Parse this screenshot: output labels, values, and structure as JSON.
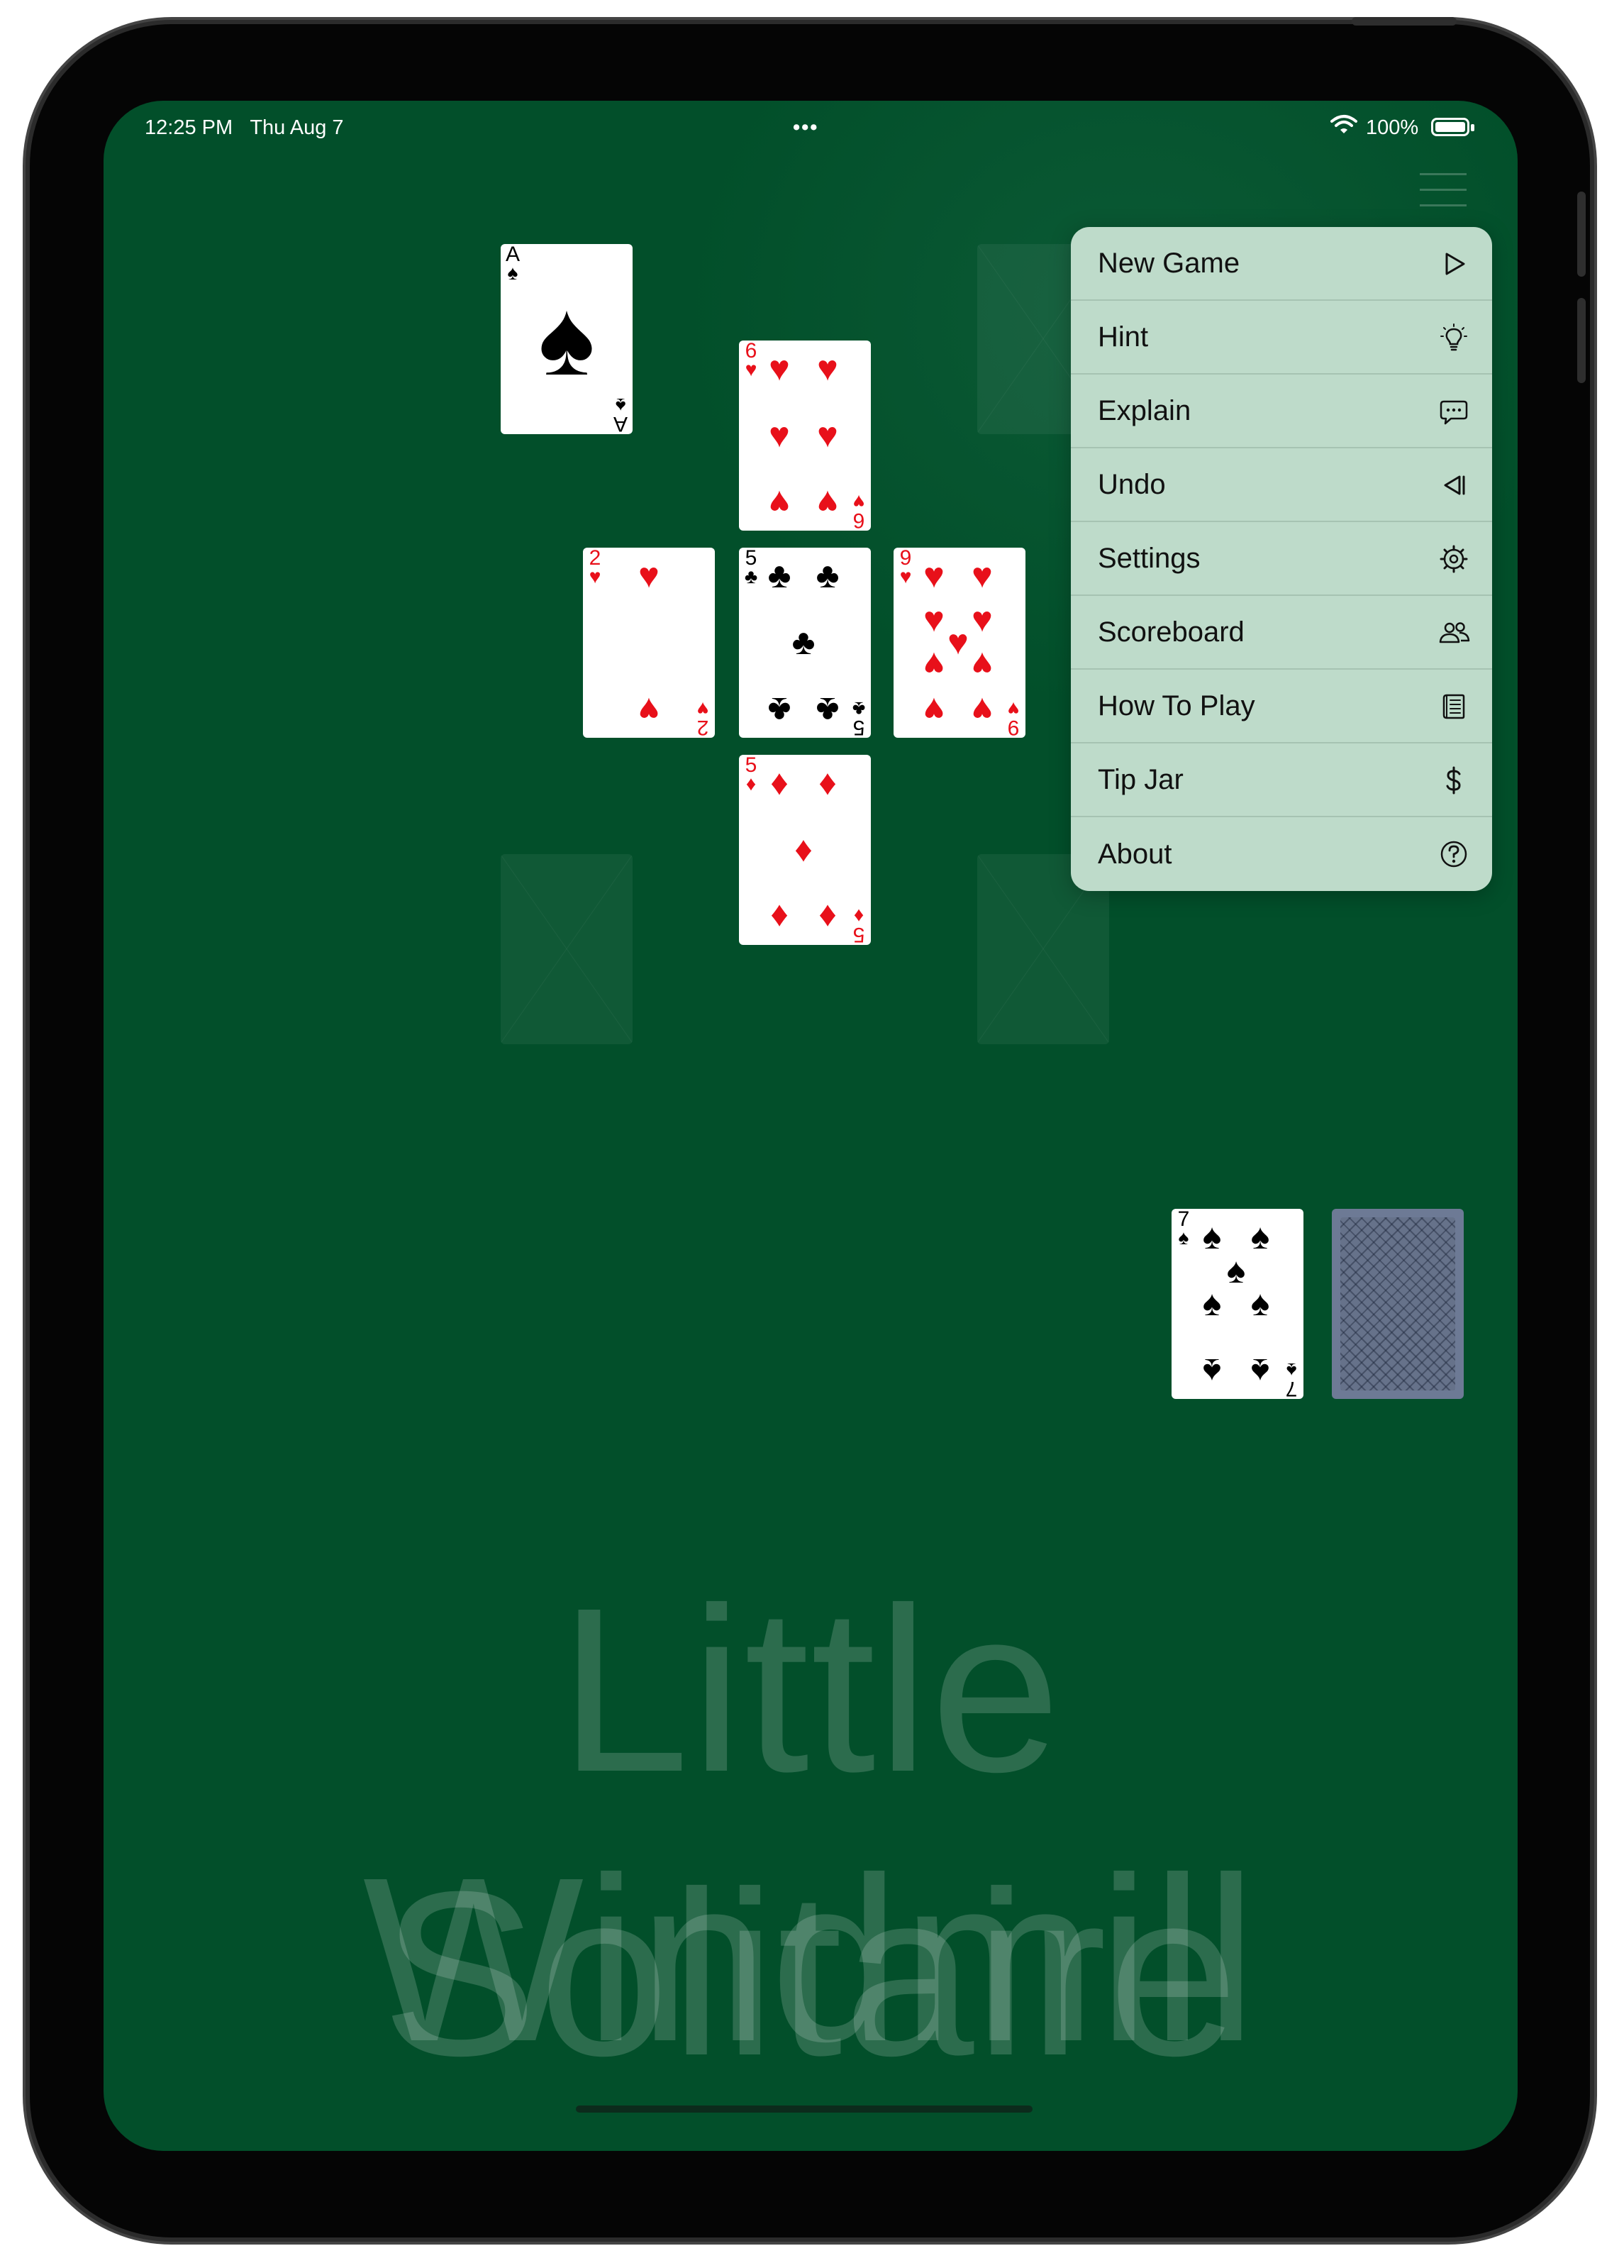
{
  "status_bar": {
    "time": "12:25 PM",
    "date": "Thu Aug 7",
    "center_dots": "•••",
    "battery": "100%"
  },
  "cards": {
    "ace": {
      "rank": "A",
      "suit": "♠"
    },
    "top": {
      "rank": "6",
      "suit": "♥"
    },
    "left": {
      "rank": "2",
      "suit": "♥"
    },
    "center": {
      "rank": "5",
      "suit": "♣"
    },
    "right": {
      "rank": "9",
      "suit": "♥"
    },
    "bottom": {
      "rank": "5",
      "suit": "♦"
    },
    "waste": {
      "rank": "7",
      "suit": "♠"
    }
  },
  "watermark": {
    "line1": "Little Windmill",
    "line2": "Solitaire"
  },
  "menu": {
    "items": [
      {
        "label": "New Game",
        "icon": "play-icon"
      },
      {
        "label": "Hint",
        "icon": "lightbulb-icon"
      },
      {
        "label": "Explain",
        "icon": "speech-bubble-icon"
      },
      {
        "label": "Undo",
        "icon": "undo-icon"
      },
      {
        "label": "Settings",
        "icon": "gear-icon"
      },
      {
        "label": "Scoreboard",
        "icon": "people-icon"
      },
      {
        "label": "How To Play",
        "icon": "book-icon"
      },
      {
        "label": "Tip Jar",
        "icon": "dollar-icon"
      },
      {
        "label": "About",
        "icon": "question-circle-icon"
      }
    ]
  },
  "colors": {
    "felt": "#024f2a",
    "menu_bg": "#bedbca",
    "red_suit": "#e8101a",
    "card_back": "#6d7a95"
  }
}
